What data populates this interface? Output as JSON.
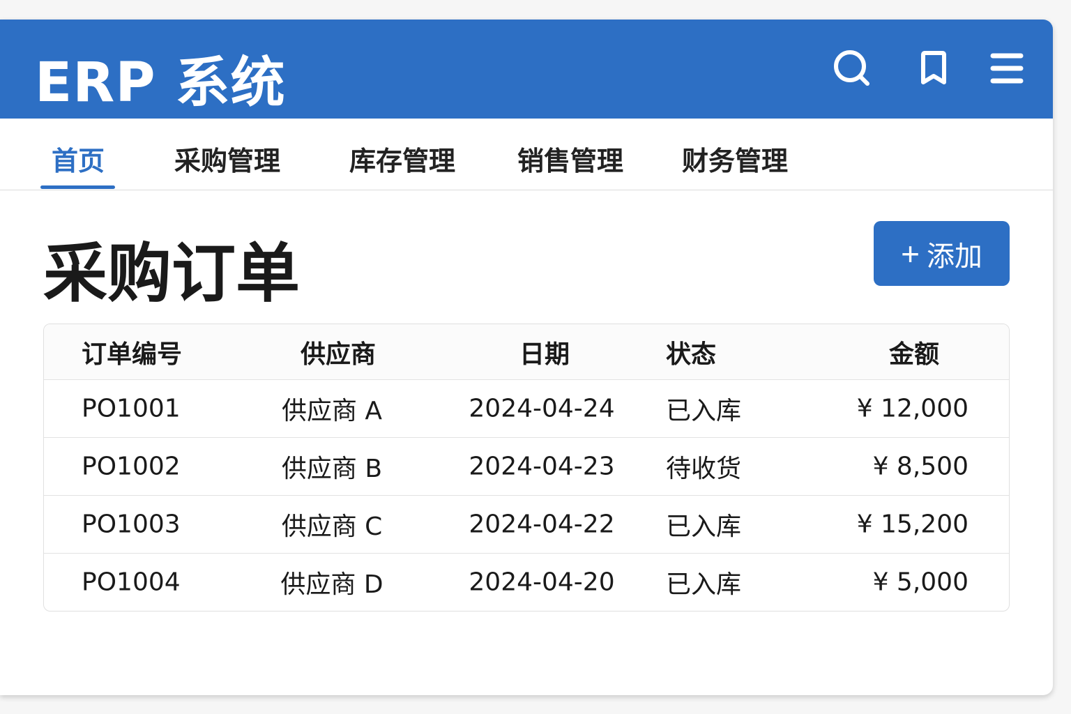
{
  "header": {
    "title": "ERP 系统"
  },
  "tabs": [
    {
      "label": "首页",
      "active": true
    },
    {
      "label": "采购管理"
    },
    {
      "label": "库存管理"
    },
    {
      "label": "销售管理"
    },
    {
      "label": "财务管理"
    }
  ],
  "page": {
    "title": "采购订单",
    "add_label": "添加",
    "add_icon": "+"
  },
  "table": {
    "headers": [
      "订单编号",
      "供应商",
      "日期",
      "状态",
      "金额"
    ],
    "rows": [
      [
        "PO1001",
        "供应商 A",
        "2024-04-24",
        "已入库",
        "¥ 12,000"
      ],
      [
        "PO1002",
        "供应商 B",
        "2024-04-23",
        "待收货",
        "¥ 8,500"
      ],
      [
        "PO1003",
        "供应商 C",
        "2024-04-22",
        "已入库",
        "¥ 15,200"
      ],
      [
        "PO1004",
        "供应商 D",
        "2024-04-20",
        "已入库",
        "¥ 5,000"
      ]
    ]
  },
  "colors": {
    "primary": "#2d6fc4"
  }
}
